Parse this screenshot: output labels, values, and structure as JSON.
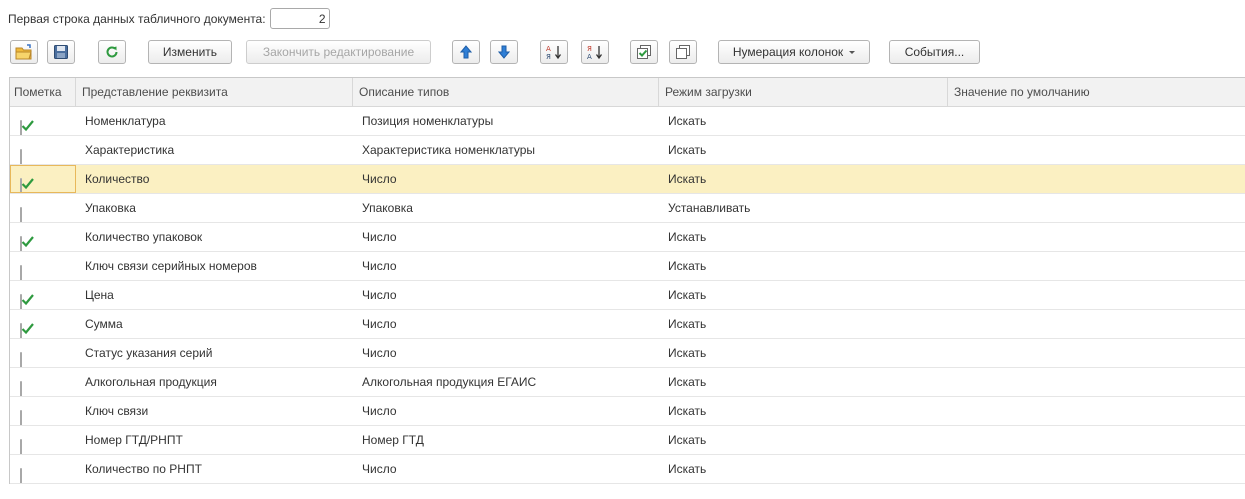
{
  "header": {
    "first_row_label": "Первая строка данных табличного документа:",
    "first_row_value": "2"
  },
  "toolbar": {
    "open_icon": "open-folder-icon",
    "save_icon": "save-icon",
    "refresh_icon": "refresh-icon",
    "edit_label": "Изменить",
    "finish_edit_label": "Закончить редактирование",
    "move_up_icon": "arrow-up-icon",
    "move_down_icon": "arrow-down-icon",
    "sort_asc_icon": "sort-asc-icon",
    "sort_desc_icon": "sort-desc-icon",
    "check_all_icon": "check-all-icon",
    "uncheck_all_icon": "uncheck-all-icon",
    "column_numbering_label": "Нумерация колонок",
    "events_label": "События..."
  },
  "table": {
    "columns": [
      "Пометка",
      "Представление реквизита",
      "Описание типов",
      "Режим загрузки",
      "Значение по умолчанию"
    ],
    "rows": [
      {
        "checked": true,
        "name": "Номенклатура",
        "type": "Позиция номенклатуры",
        "mode": "Искать",
        "default": ""
      },
      {
        "checked": false,
        "name": "Характеристика",
        "type": "Характеристика номенклатуры",
        "mode": "Искать",
        "default": ""
      },
      {
        "checked": true,
        "name": "Количество",
        "type": "Число",
        "mode": "Искать",
        "default": ""
      },
      {
        "checked": false,
        "name": "Упаковка",
        "type": "Упаковка",
        "mode": "Устанавливать",
        "default": ""
      },
      {
        "checked": true,
        "name": "Количество упаковок",
        "type": "Число",
        "mode": "Искать",
        "default": ""
      },
      {
        "checked": false,
        "name": "Ключ связи серийных номеров",
        "type": "Число",
        "mode": "Искать",
        "default": ""
      },
      {
        "checked": true,
        "name": "Цена",
        "type": "Число",
        "mode": "Искать",
        "default": ""
      },
      {
        "checked": true,
        "name": "Сумма",
        "type": "Число",
        "mode": "Искать",
        "default": ""
      },
      {
        "checked": false,
        "name": "Статус указания серий",
        "type": "Число",
        "mode": "Искать",
        "default": ""
      },
      {
        "checked": false,
        "name": "Алкогольная продукция",
        "type": "Алкогольная продукция ЕГАИС",
        "mode": "Искать",
        "default": ""
      },
      {
        "checked": false,
        "name": "Ключ связи",
        "type": "Число",
        "mode": "Искать",
        "default": ""
      },
      {
        "checked": false,
        "name": "Номер ГТД/РНПТ",
        "type": "Номер ГТД",
        "mode": "Искать",
        "default": ""
      },
      {
        "checked": false,
        "name": "Количество по РНПТ",
        "type": "Число",
        "mode": "Искать",
        "default": ""
      }
    ],
    "selected_row": 2
  },
  "colors": {
    "selected_row_bg": "#fbf0c2",
    "check_color": "#2e9a3f",
    "arrow_blue": "#2f7fd6"
  }
}
